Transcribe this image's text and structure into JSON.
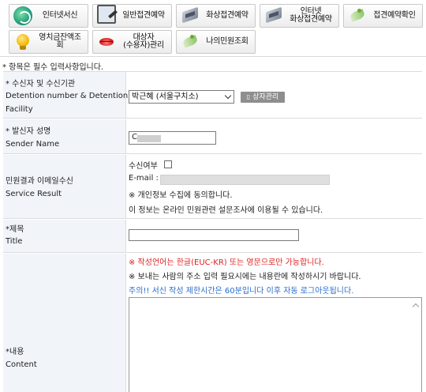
{
  "nav": {
    "items": [
      {
        "label": "인터넷서신",
        "icon": "globe-icon"
      },
      {
        "label": "일반접견예약",
        "icon": "monitor-icon"
      },
      {
        "label": "화상접견예약",
        "icon": "camera-icon"
      },
      {
        "label_line1": "인터넷",
        "label_line2": "화상접견예약",
        "icon": "camera-icon"
      },
      {
        "label": "접견예약확인",
        "icon": "leaf-icon"
      },
      {
        "label": "영치금잔액조회",
        "icon": "bulb-icon"
      },
      {
        "label_line1": "대상자",
        "label_line2": "(수용자)관리",
        "icon": "lips-icon"
      },
      {
        "label": "나의민원조회",
        "icon": "leaf-icon"
      }
    ]
  },
  "required_note": "* 항목은 필수 입력사항입니다.",
  "form": {
    "recipient": {
      "label_ko": "* 수신자 및 수신기관",
      "label_en_line1": "Detention number & Detention",
      "label_en_line2": "Facility",
      "selected": "박근혜 (서울구치소)",
      "manage_button": "상자관리"
    },
    "sender": {
      "label_ko": "* 발신자 성명",
      "label_en": "Sender Name",
      "value": "C"
    },
    "service_result": {
      "label_ko": "민원결과 이메일수신",
      "label_en": "Service Result",
      "receive_label": "수신여부",
      "email_label": "E-mail :",
      "privacy_line1": "※ 개인정보 수집에 동의합니다.",
      "privacy_line2": "이 정보는 온라인 민원관련 설문조사에 이용될 수 있습니다."
    },
    "title": {
      "label_ko": "*제목",
      "label_en": "Title",
      "value": ""
    },
    "content": {
      "label_ko": "*내용",
      "label_en": "Content",
      "notice_red": "※ 작성언어는 한글(EUC-KR) 또는 영문으로만 가능합니다.",
      "notice_black": "※ 보내는 사람의 주소 입력 필요시에는 내용란에 작성하시기 바랍니다.",
      "notice_blue": "주의!! 서신 작성 제한시간은 60분입니다 이후 자동 로그아웃됩니다."
    }
  }
}
